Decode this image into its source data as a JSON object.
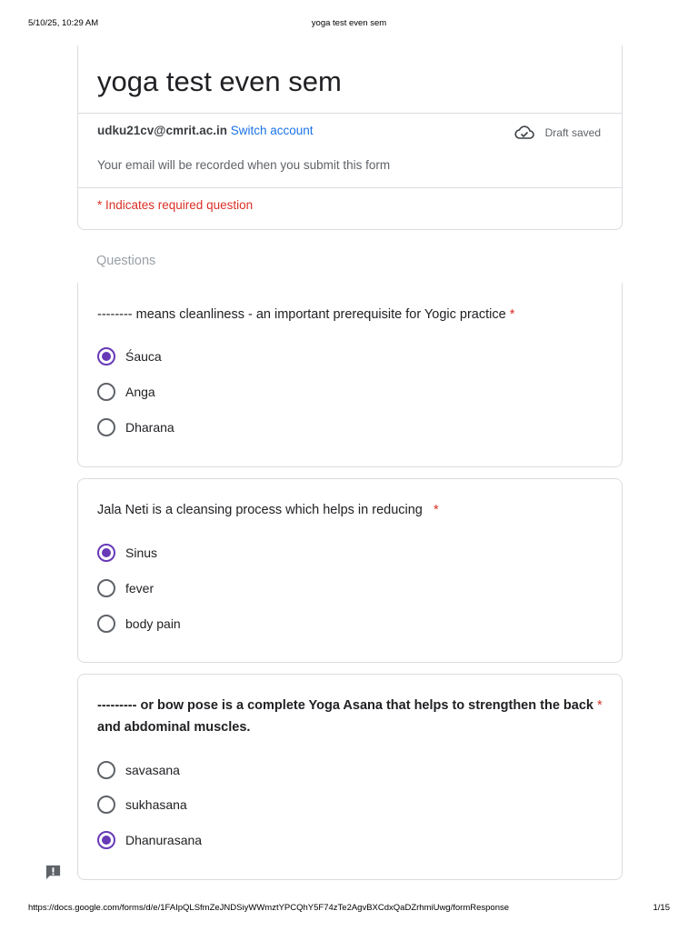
{
  "print_header": {
    "datetime": "5/10/25, 10:29 AM",
    "title": "yoga test even sem"
  },
  "form": {
    "title": "yoga test even sem",
    "account_email": "udku21cv@cmrit.ac.in",
    "switch_account": "Switch account",
    "draft_status": "Draft saved",
    "email_note": "Your email will be recorded when you submit this form",
    "required_note": "* Indicates required question"
  },
  "section_label": "Questions",
  "questions": [
    {
      "text": "-------- means cleanliness - an important prerequisite for Yogic practice",
      "required_mark": "*",
      "options": [
        "Śauca",
        "Anga",
        "Dharana"
      ],
      "selected": 0
    },
    {
      "text": "Jala Neti is a cleansing process which helps in reducing",
      "required_mark": "*",
      "options": [
        "Sinus",
        "fever",
        "body pain"
      ],
      "selected": 0
    },
    {
      "text_line1": "--------- or bow pose is a complete Yoga Asana that helps to strengthen the back",
      "text_line2": "and abdominal muscles.",
      "required_mark": "*",
      "options": [
        "savasana",
        "sukhasana",
        "Dhanurasana"
      ],
      "selected": 2
    }
  ],
  "print_footer": {
    "url": "https://docs.google.com/forms/d/e/1FAIpQLSfmZeJNDSiyWWmztYPCQhY5F74zTe2AgvBXCdxQaDZrhmiUwg/formResponse",
    "page": "1/15"
  },
  "colors": {
    "accent": "#673ab7",
    "link": "#1a73e8",
    "required": "#d93025"
  },
  "icons": {
    "draft": "cloud-check-icon",
    "feedback": "feedback-icon"
  }
}
